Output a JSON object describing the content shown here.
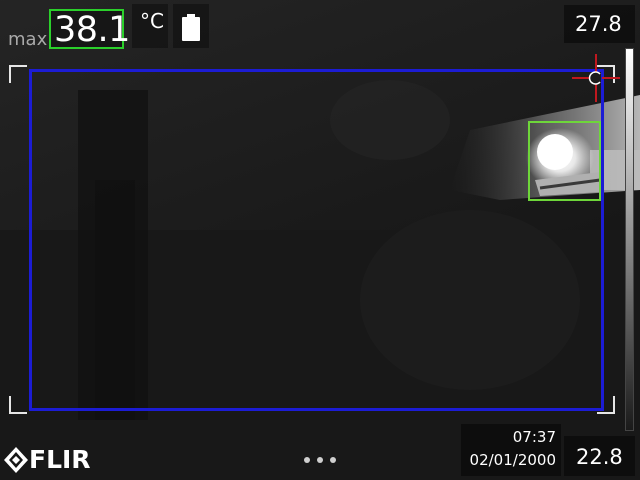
{
  "readout": {
    "max_label": "max",
    "max_value": "38.1",
    "unit": "°C",
    "battery_icon": "battery-icon"
  },
  "scale": {
    "max": "27.8",
    "min": "22.8"
  },
  "footer": {
    "logo_text": "FLIR",
    "time": "07:37",
    "date": "02/01/2000",
    "more_icon": "more-dots-icon"
  },
  "colors": {
    "measure_box": "#1c1cd4",
    "hotspot_box": "#6ed63a",
    "max_value_border": "#2bd02b",
    "crosshair": "#c0181f"
  }
}
